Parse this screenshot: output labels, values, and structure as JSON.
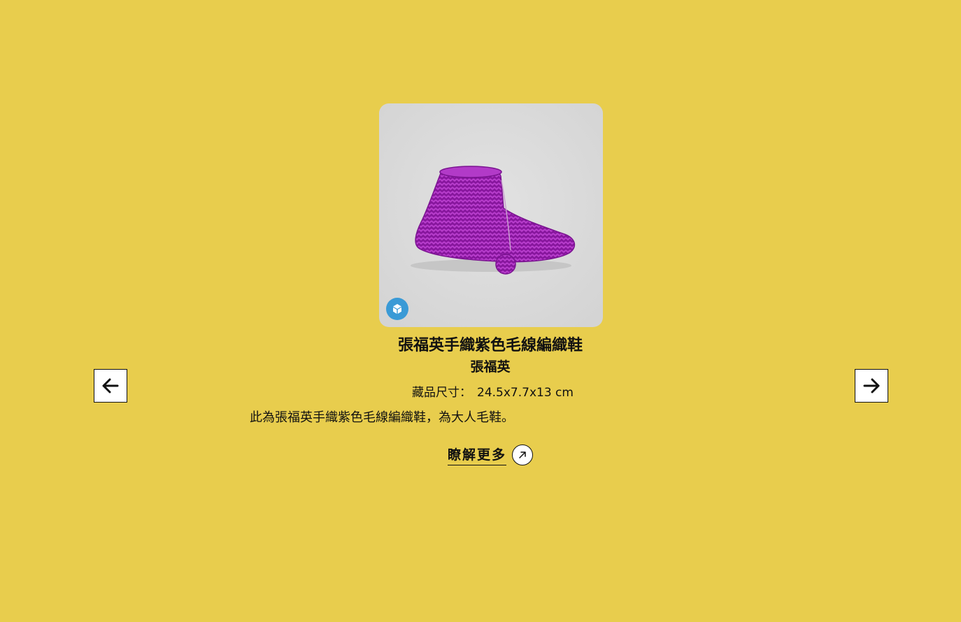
{
  "item": {
    "title": "張福英手織紫色毛線編織鞋",
    "artist": "張福英",
    "size_label": "藏品尺寸：",
    "size_value": "24.5x7.7x13 cm",
    "description": "此為張福英手織紫色毛線編織鞋，為大人毛鞋。"
  },
  "viewer": {
    "badge_icon": "sketchfab-logo-icon",
    "model_icon": "knitted-shoe-model"
  },
  "actions": {
    "learn_more_label": "瞭解更多",
    "learn_more_icon": "arrow-up-right-icon"
  },
  "navigation": {
    "prev_icon": "arrow-left-icon",
    "next_icon": "arrow-right-icon"
  },
  "colors": {
    "background": "#e8cd4d",
    "viewer_bg": "#d9d9d9",
    "shoe": "#9a1fb0",
    "badge": "#3a9ad6"
  }
}
